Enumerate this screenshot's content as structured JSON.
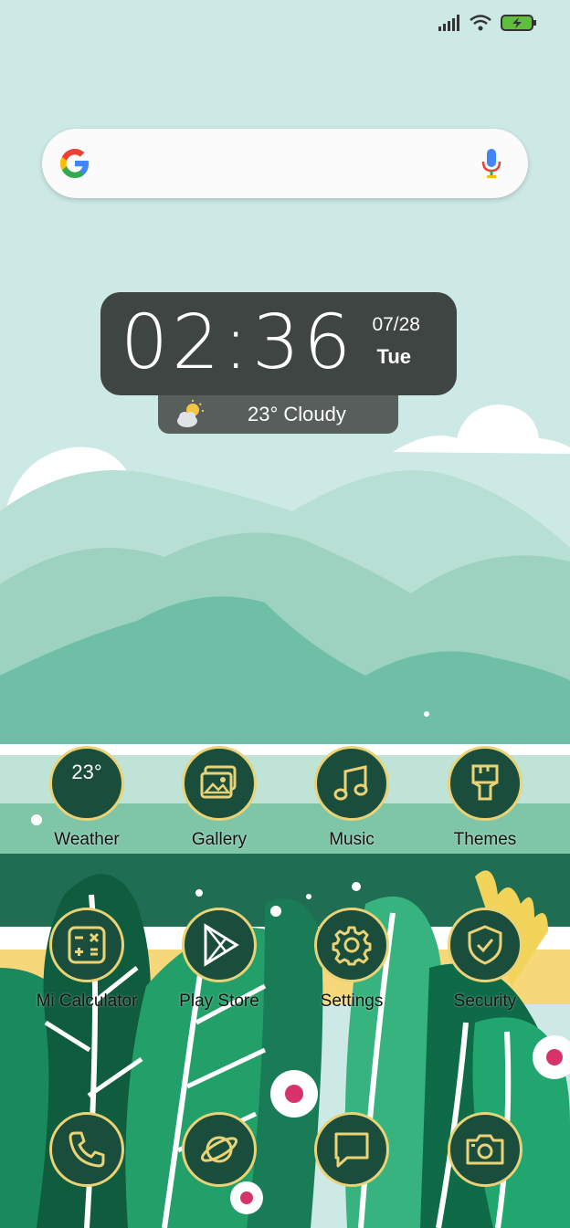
{
  "status_bar": {
    "icons": [
      "signal-icon",
      "wifi-icon",
      "battery-charging-icon"
    ]
  },
  "search_bar": {
    "icons": [
      "google-g-icon",
      "microphone-icon"
    ]
  },
  "clock_widget": {
    "time": "02:36",
    "date": "07/28",
    "day": "Tue",
    "weather": "23° Cloudy",
    "weather_icon": "partly-cloudy-icon"
  },
  "apps_row1": [
    {
      "label": "Weather",
      "icon": "weather-temp-icon",
      "value": "23°"
    },
    {
      "label": "Gallery",
      "icon": "gallery-icon"
    },
    {
      "label": "Music",
      "icon": "music-note-icon"
    },
    {
      "label": "Themes",
      "icon": "paintbrush-icon"
    }
  ],
  "apps_row2": [
    {
      "label": "Mi Calculator",
      "icon": "calculator-icon"
    },
    {
      "label": "Play Store",
      "icon": "play-store-icon"
    },
    {
      "label": "Settings",
      "icon": "gear-icon"
    },
    {
      "label": "Security",
      "icon": "shield-check-icon"
    }
  ],
  "dock": [
    {
      "icon": "phone-icon"
    },
    {
      "icon": "browser-planet-icon"
    },
    {
      "icon": "messages-icon"
    },
    {
      "icon": "camera-icon"
    }
  ],
  "colors": {
    "icon_bg": "#1a4d3b",
    "icon_stroke": "#ead277",
    "widget_bg": "#3f4543"
  }
}
